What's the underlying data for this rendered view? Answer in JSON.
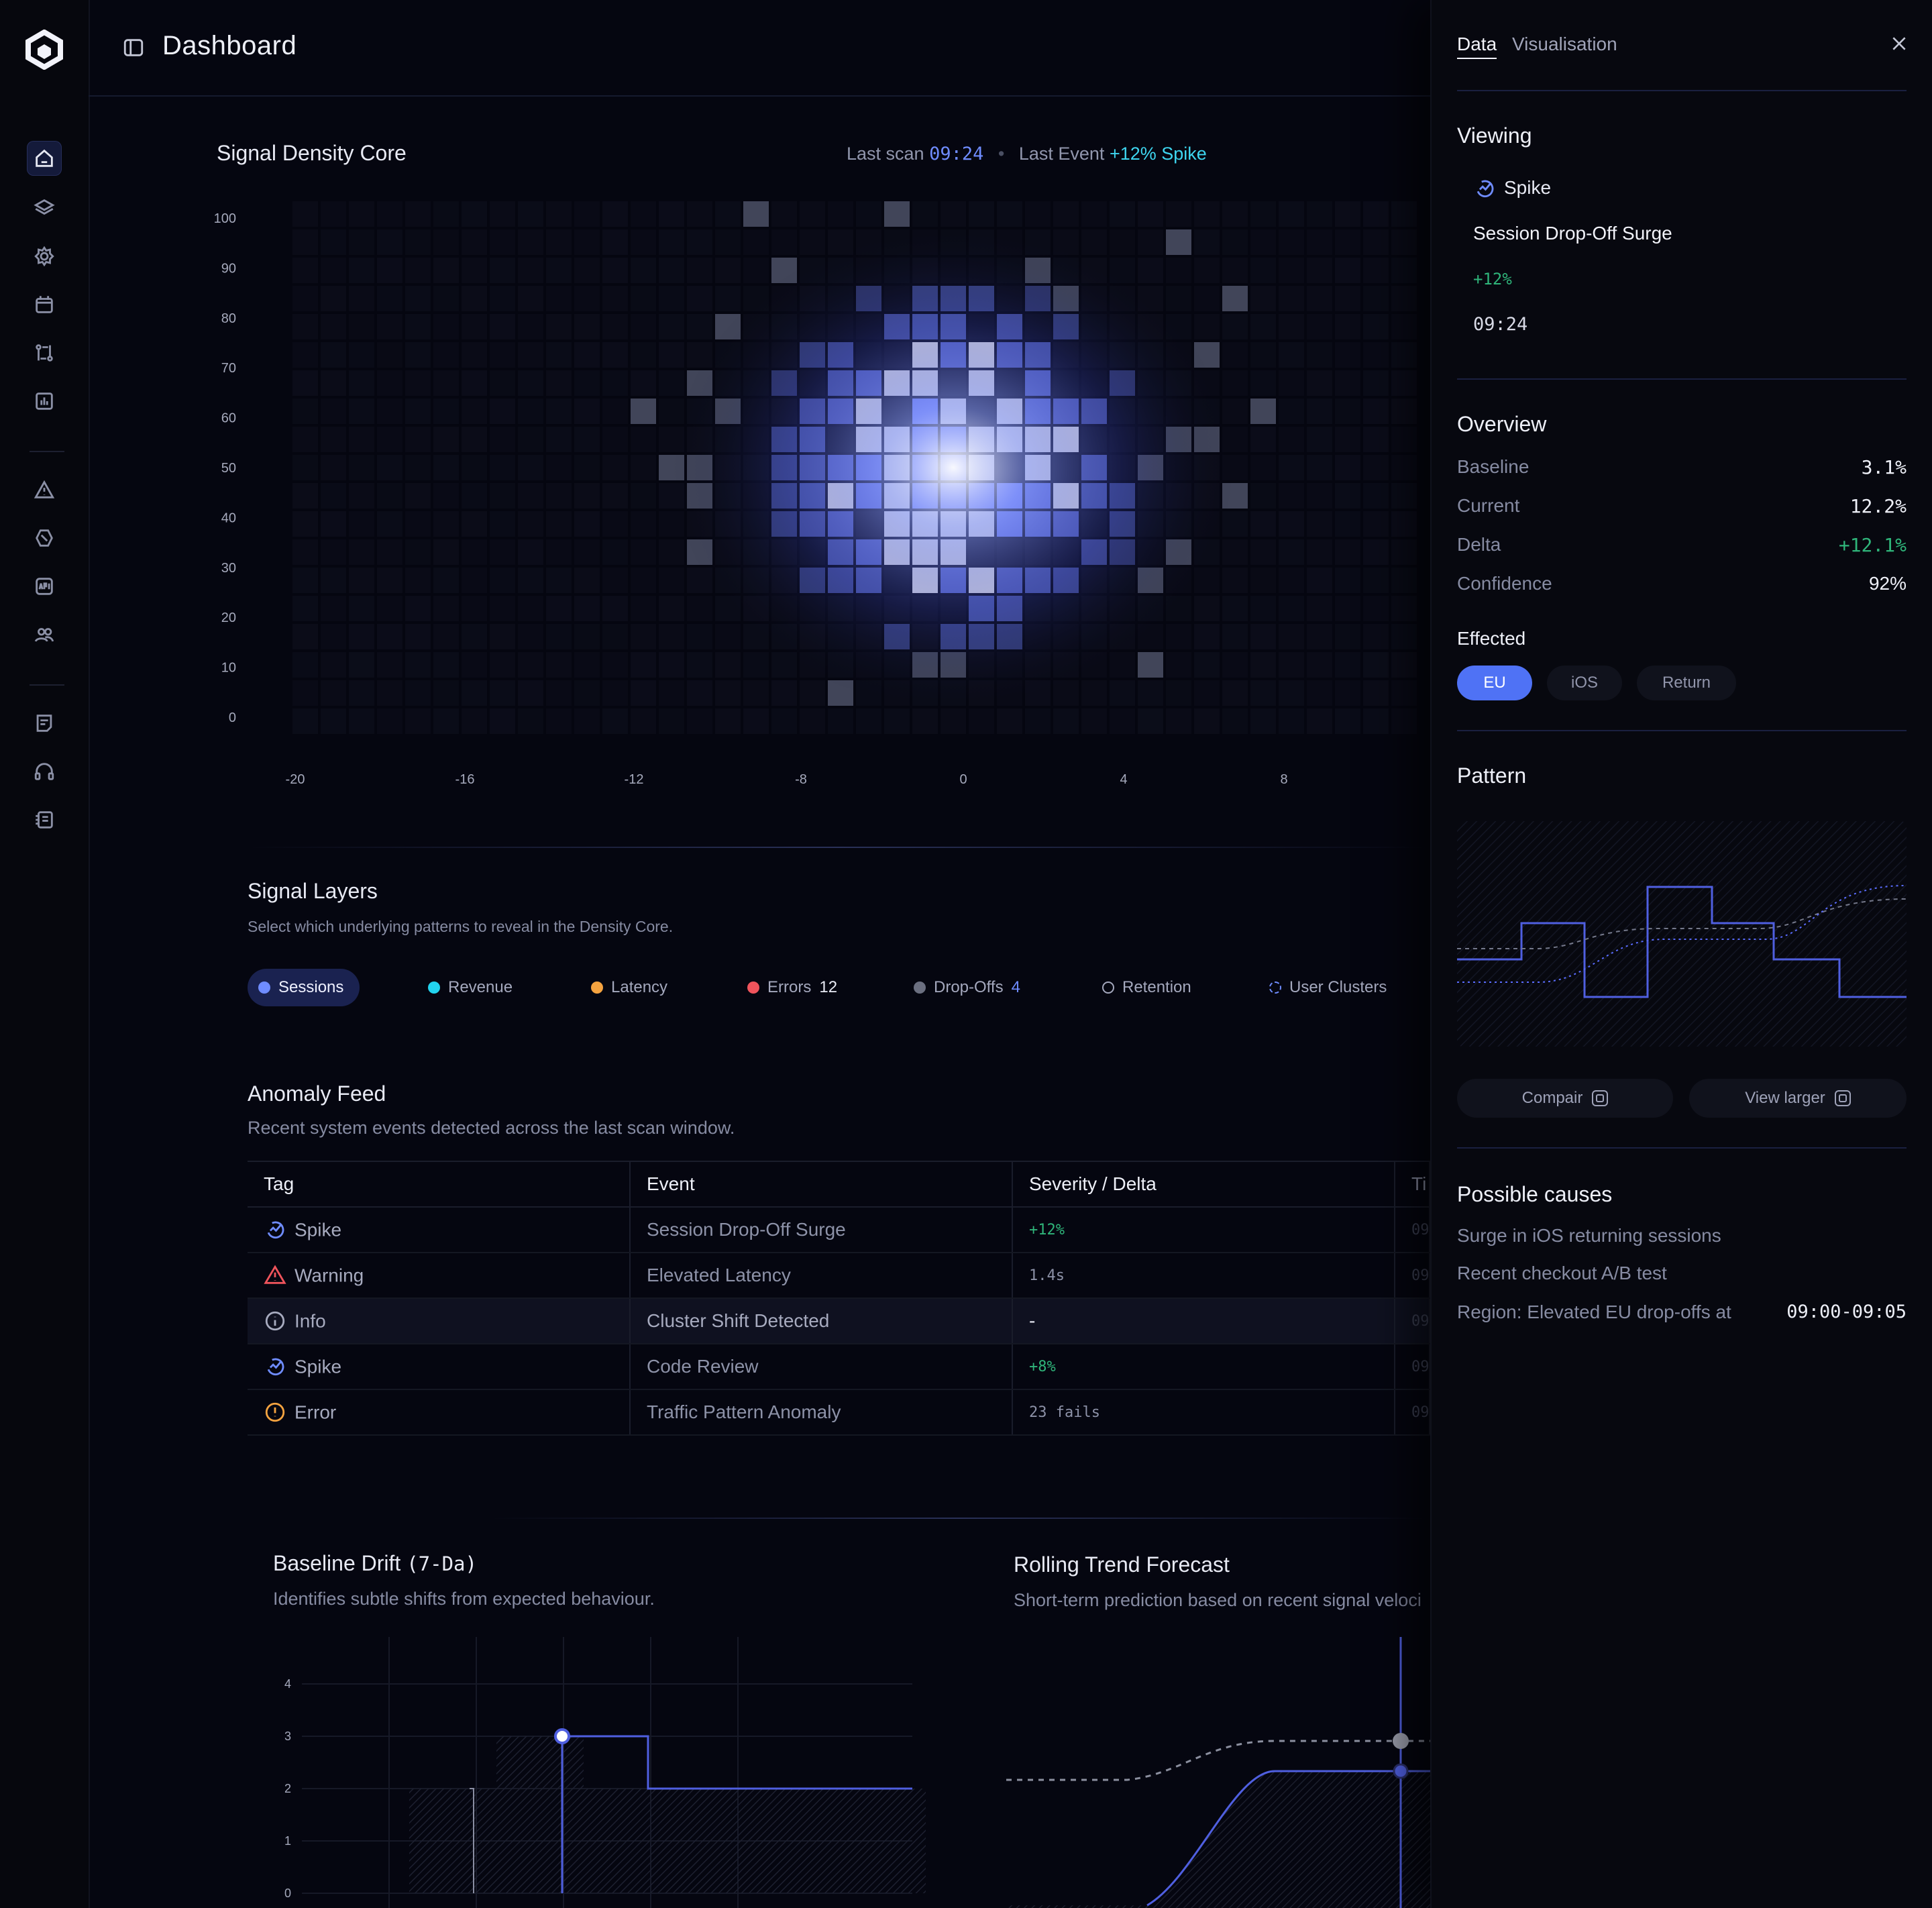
{
  "header": {
    "title": "Dashboard"
  },
  "sidebar": {
    "items": [
      {
        "icon": "home-icon",
        "active": true
      },
      {
        "icon": "layers-icon"
      },
      {
        "icon": "settings-icon"
      },
      {
        "icon": "calendar-icon"
      },
      {
        "icon": "git-compare-icon"
      },
      {
        "icon": "bar-chart-icon"
      },
      {
        "icon": "alert-icon"
      },
      {
        "icon": "tag-icon"
      },
      {
        "icon": "api-icon"
      },
      {
        "icon": "users-icon"
      },
      {
        "icon": "notes-icon"
      },
      {
        "icon": "headset-icon"
      },
      {
        "icon": "docs-icon"
      }
    ]
  },
  "heatmap": {
    "title": "Signal Density Core",
    "last_scan_label": "Last scan",
    "last_scan_time": "09:24",
    "last_event_label": "Last Event",
    "last_event_value": "+12% Spike"
  },
  "chart_data": [
    {
      "type": "heatmap",
      "y_ticks": [
        "100",
        "90",
        "80",
        "70",
        "60",
        "50",
        "40",
        "30",
        "20",
        "10",
        "0"
      ],
      "x_ticks": [
        "-20",
        "-16",
        "-12",
        "-8",
        "0",
        "4",
        "8"
      ],
      "peak": {
        "x": 0,
        "y": 50
      },
      "accent": "#5a6cff"
    },
    {
      "type": "line",
      "title": "Baseline Drift",
      "title_suffix": "(7-Da)",
      "subtitle": "Identifies subtle shifts from expected behaviour.",
      "y_ticks": [
        "4",
        "3",
        "2",
        "1",
        "0"
      ],
      "ylim": [
        0,
        4
      ],
      "series": [
        {
          "values": [
            0,
            2,
            3,
            2,
            2
          ]
        }
      ]
    },
    {
      "type": "line",
      "title": "Rolling Trend Forecast",
      "subtitle": "Short-term prediction based on recent signal veloci"
    }
  ],
  "layers": {
    "title": "Signal Layers",
    "subtitle": "Select which underlying patterns to reveal in the Density Core.",
    "chips": [
      {
        "label": "Sessions",
        "color": "#6f8cff",
        "selected": true
      },
      {
        "label": "Revenue",
        "color": "#22d3ee"
      },
      {
        "label": "Latency",
        "color": "#f5a340"
      },
      {
        "label": "Errors",
        "count": "12",
        "color": "#f0545c"
      },
      {
        "label": "Drop-Offs",
        "count": "4",
        "color": "#6b6f80"
      },
      {
        "label": "Retention",
        "color": "ring"
      },
      {
        "label": "User Clusters",
        "color": "dashed"
      }
    ]
  },
  "feed": {
    "title": "Anomaly Feed",
    "subtitle": "Recent system events detected across the last scan window.",
    "columns": [
      "Tag",
      "Event",
      "Severity / Delta",
      "Ti"
    ],
    "rows": [
      {
        "tag": "Spike",
        "icon": "spike-icon",
        "event": "Session Drop-Off Surge",
        "delta": "+12%",
        "time": "09"
      },
      {
        "tag": "Warning",
        "icon": "warning-icon",
        "event": "Elevated Latency",
        "delta": "1.4s",
        "time": "09"
      },
      {
        "tag": "Info",
        "icon": "info-icon",
        "event": "Cluster Shift Detected",
        "delta": "-",
        "time": "09"
      },
      {
        "tag": "Spike",
        "icon": "spike-icon",
        "event": "Code Review",
        "delta": "+8%",
        "time": "09"
      },
      {
        "tag": "Error",
        "icon": "error-icon",
        "event": "Traffic Pattern Anomaly",
        "delta": "23 fails",
        "time": "09"
      }
    ]
  },
  "panel": {
    "tabs": [
      "Data",
      "Visualisation"
    ],
    "viewing_title": "Viewing",
    "viewing_tag": "Spike",
    "viewing_event": "Session Drop-Off Surge",
    "viewing_delta": "+12%",
    "viewing_time": "09:24",
    "overview_title": "Overview",
    "overview": [
      {
        "label": "Baseline",
        "value": "3.1%"
      },
      {
        "label": "Current",
        "value": "12.2%"
      },
      {
        "label": "Delta",
        "value": "+12.1%"
      },
      {
        "label": "Confidence",
        "value": "92%"
      }
    ],
    "effected_title": "Effected",
    "effected": [
      "EU",
      "iOS",
      "Return"
    ],
    "pattern_title": "Pattern",
    "compare_label": "Compair",
    "view_larger_label": "View larger",
    "causes_title": "Possible causes",
    "causes": [
      "Surge in iOS returning sessions",
      "Recent checkout A/B test",
      "Region: Elevated EU drop-offs at"
    ],
    "cause_time": "09:00-09:05"
  },
  "colors": {
    "accent": "#5a6cff",
    "positive": "#2fb57a",
    "cyan": "#3ed6f0"
  }
}
